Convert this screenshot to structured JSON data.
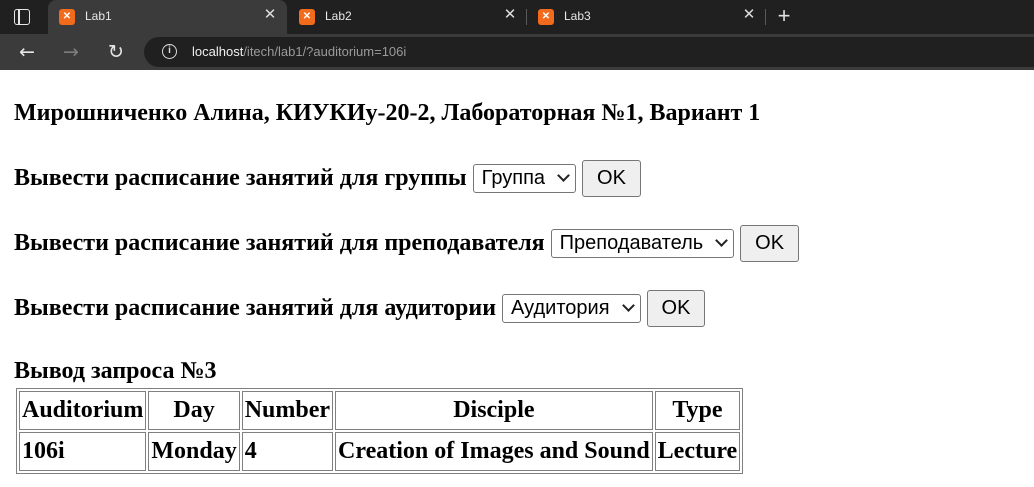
{
  "browser": {
    "tabs": [
      {
        "label": "Lab1",
        "active": true
      },
      {
        "label": "Lab2",
        "active": false
      },
      {
        "label": "Lab3",
        "active": false
      }
    ],
    "close_glyph": "✕",
    "newtab_glyph": "+",
    "url_host": "localhost",
    "url_path": "/itech/lab1/?auditorium=106i"
  },
  "page": {
    "title": "Мирошниченко Алина, КИУКИу-20-2, Лабораторная №1, Вариант 1",
    "queries": [
      {
        "label": "Вывести расписание занятий для группы",
        "select_value": "Группа",
        "button": "OK"
      },
      {
        "label": "Вывести расписание занятий для преподавателя",
        "select_value": "Преподаватель",
        "button": "OK"
      },
      {
        "label": "Вывести расписание занятий для аудитории",
        "select_value": "Аудитория",
        "button": "OK"
      }
    ],
    "result_title": "Вывод запроса №3",
    "table": {
      "headers": [
        "Auditorium",
        "Day",
        "Number",
        "Disciple",
        "Type"
      ],
      "rows": [
        [
          "106i",
          "Monday",
          "4",
          "Creation of Images and Sound",
          "Lecture"
        ]
      ]
    }
  },
  "colors": {
    "tabbar_bg": "#202020",
    "toolbar_bg": "#3b3b3b",
    "favicon": "#f26a1b"
  }
}
